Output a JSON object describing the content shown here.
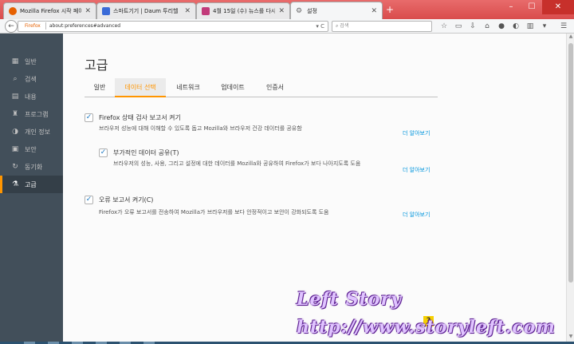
{
  "window": {
    "tabs": [
      {
        "label": "Mozilla Firefox 시작 페이지",
        "icon": "firefox-icon",
        "color": "#e66000"
      },
      {
        "label": "스마트기기 | Daum 투리헬",
        "icon": "daum-icon",
        "color": "#3a6bd8"
      },
      {
        "label": "4월 15일 (수) 뉴스를 다시...",
        "icon": "news-icon",
        "color": "#c23a7a"
      },
      {
        "label": "설정",
        "icon": "gear-icon",
        "color": "#666666"
      }
    ],
    "new_tab": "+",
    "controls": {
      "minimize": "–",
      "maximize": "☐",
      "close": "✕"
    }
  },
  "navbar": {
    "back": "←",
    "url_brand": "Firefox",
    "url": "about:preferences#advanced",
    "url_tools": "▾ C",
    "search_placeholder": "검색"
  },
  "sidebar": {
    "items": [
      {
        "label": "일반",
        "icon": "▦"
      },
      {
        "label": "검색",
        "icon": "⌕"
      },
      {
        "label": "내용",
        "icon": "▤"
      },
      {
        "label": "프로그램",
        "icon": "♜"
      },
      {
        "label": "개인 정보",
        "icon": "◑"
      },
      {
        "label": "보안",
        "icon": "▣"
      },
      {
        "label": "동기화",
        "icon": "↻"
      },
      {
        "label": "고급",
        "icon": "⚗"
      }
    ],
    "active_index": 7
  },
  "main": {
    "title": "고급",
    "tabs": [
      "일반",
      "데이터 선택",
      "네트워크",
      "업데이트",
      "인증서"
    ],
    "active_tab": 1,
    "options": [
      {
        "label": "Firefox 상태 검사 보고서 켜기",
        "checked": true,
        "desc": "브라우저 성능에 대해 이해할 수 있도록 돕고 Mozilla와 브라우저 건강 데이터를 공유함",
        "more": "더 알아보기"
      },
      {
        "label": "부가적인 데이터 공유(T)",
        "checked": true,
        "desc": "브라우저의 성능, 사용, 그리고 설정에 대한 데이터를 Mozilla와 공유하여 Firefox가 보다 나아지도록 도움",
        "more": "더 알아보기"
      },
      {
        "label": "오류 보고서 켜기(C)",
        "checked": true,
        "desc": "Firefox가 오류 보고서를 전송하여 Mozilla가 브라우저를 보다 안정적이고 보안이 강화되도록 도움",
        "more": "더 알아보기"
      }
    ]
  },
  "watermark": {
    "line1": "Left Story",
    "line2": "http://www.storyleft.com",
    "badge": "?"
  }
}
